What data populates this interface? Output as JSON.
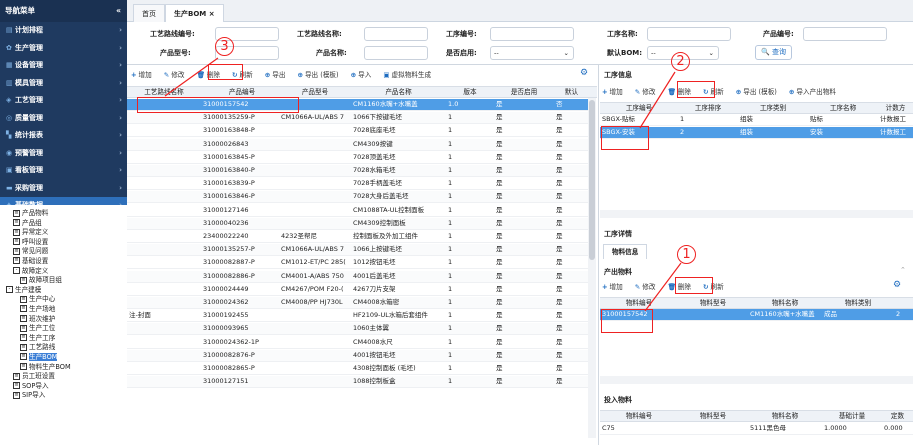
{
  "sidebar": {
    "title": "导航菜单",
    "collapse": "«",
    "menu": [
      {
        "label": "计划排程",
        "icon": "▤"
      },
      {
        "label": "生产管理",
        "icon": "✿"
      },
      {
        "label": "设备管理",
        "icon": "▦"
      },
      {
        "label": "模具管理",
        "icon": "▥"
      },
      {
        "label": "工艺管理",
        "icon": "◈"
      },
      {
        "label": "质量管理",
        "icon": "◎"
      },
      {
        "label": "统计报表",
        "icon": "▚"
      },
      {
        "label": "预警管理",
        "icon": "◉"
      },
      {
        "label": "看板管理",
        "icon": "▣"
      },
      {
        "label": "采购管理",
        "icon": "▬"
      },
      {
        "label": "基础数据",
        "icon": "✦"
      }
    ],
    "tree": [
      {
        "label": "产品物料",
        "d": 1,
        "t": "l"
      },
      {
        "label": "产品组",
        "d": 1,
        "t": "l"
      },
      {
        "label": "异常定义",
        "d": 1,
        "t": "l"
      },
      {
        "label": "呼叫设置",
        "d": 1,
        "t": "l"
      },
      {
        "label": "常见问题",
        "d": 1,
        "t": "l"
      },
      {
        "label": "基础设置",
        "d": 1,
        "t": "l"
      },
      {
        "label": "故障定义",
        "d": 1,
        "t": "f"
      },
      {
        "label": "故障项目组",
        "d": 2,
        "t": "l"
      },
      {
        "label": "生产建模",
        "d": 0,
        "t": "f"
      },
      {
        "label": "生产中心",
        "d": 2,
        "t": "l"
      },
      {
        "label": "生产场地",
        "d": 2,
        "t": "l"
      },
      {
        "label": "班次维护",
        "d": 2,
        "t": "l"
      },
      {
        "label": "生产工位",
        "d": 2,
        "t": "l"
      },
      {
        "label": "生产工序",
        "d": 2,
        "t": "l"
      },
      {
        "label": "工艺路线",
        "d": 2,
        "t": "l"
      },
      {
        "label": "生产BOM",
        "d": 2,
        "t": "l",
        "sel": true
      },
      {
        "label": "物料生产BOM",
        "d": 2,
        "t": "l"
      },
      {
        "label": "员工班设置",
        "d": 1,
        "t": "l"
      },
      {
        "label": "SOP导入",
        "d": 1,
        "t": "l"
      },
      {
        "label": "SIP导入",
        "d": 1,
        "t": "l"
      }
    ]
  },
  "tabs": [
    "首页",
    "生产BOM ×"
  ],
  "filters": {
    "route_no": "工艺路线编号:",
    "route_name": "工艺路线名称:",
    "proc_no": "工序编号:",
    "proc_name": "工序名称:",
    "prod_no": "产品编号:",
    "prod_type": "产品型号:",
    "prod_name": "产品名称:",
    "enabled": "是否启用:",
    "enabled_val": "--",
    "def_bom": "默认BOM:",
    "def_bom_val": "--",
    "query": "查询"
  },
  "left_toolbar": [
    "增加",
    "修改",
    "删除",
    "刷新",
    "导出",
    "导出 (模板)",
    "导入",
    "虚拟物料生成"
  ],
  "left_headers": [
    "工艺路线名称",
    "产品编号",
    "产品型号",
    "产品名称",
    "版本",
    "是否启用",
    "默认"
  ],
  "left_rows": [
    [
      "",
      "31000157542",
      "",
      "CM1160水嘴+水嘴盖",
      "1.0",
      "是",
      "否"
    ],
    [
      "",
      "31000135259-P",
      "CM1066A-UL/ABS 7",
      "1066下按键毛坯",
      "1",
      "是",
      "是"
    ],
    [
      "",
      "31000163848-P",
      "",
      "7028底座毛坯",
      "1",
      "是",
      "是"
    ],
    [
      "",
      "31000026843",
      "",
      "CM4309按键",
      "1",
      "是",
      "是"
    ],
    [
      "",
      "31000163845-P",
      "",
      "7028顶盖毛坯",
      "1",
      "是",
      "是"
    ],
    [
      "",
      "31000163840-P",
      "",
      "7028水箱毛坯",
      "1",
      "是",
      "是"
    ],
    [
      "",
      "31000163839-P",
      "",
      "7028手柄盖毛坯",
      "1",
      "是",
      "是"
    ],
    [
      "",
      "31000163846-P",
      "",
      "7028大身后盖毛坯",
      "1",
      "是",
      "是"
    ],
    [
      "",
      "31000127146",
      "",
      "CM1088TA-UL控制面板",
      "1",
      "是",
      "是"
    ],
    [
      "",
      "31000040236",
      "",
      "CM4309控制面板",
      "1",
      "是",
      "是"
    ],
    [
      "",
      "23400022240",
      "4232圣帮尼",
      "控制面板及外加工组件",
      "1",
      "是",
      "是"
    ],
    [
      "",
      "31000135257-P",
      "CM1066A-UL/ABS 7",
      "1066上按键毛坯",
      "1",
      "是",
      "是"
    ],
    [
      "",
      "31000082887-P",
      "CM1012-ET/PC 285(",
      "1012按钮毛坯",
      "1",
      "是",
      "是"
    ],
    [
      "",
      "31000082886-P",
      "CM4001-A/ABS 750",
      "4001后盖毛坯",
      "1",
      "是",
      "是"
    ],
    [
      "",
      "31000024449",
      "CM4267/POM F20-(",
      "4267刀片支架",
      "1",
      "是",
      "是"
    ],
    [
      "",
      "31000024362",
      "CM4008/PP HJ730L",
      "CM4008水箱密",
      "1",
      "是",
      "是"
    ],
    [
      "注-封面",
      "31000192455",
      "",
      "HF2109-UL水箱后套组件",
      "1",
      "是",
      "是"
    ],
    [
      "",
      "31000093965",
      "",
      "1060主体翼",
      "1",
      "是",
      "是"
    ],
    [
      "",
      "31000024362-1P",
      "",
      "CM4008水尺",
      "1",
      "是",
      "是"
    ],
    [
      "",
      "31000082876-P",
      "",
      "4001按钮毛坯",
      "1",
      "是",
      "是"
    ],
    [
      "",
      "31000082865-P",
      "",
      "4308控制面板 (毛坯)",
      "1",
      "是",
      "是"
    ],
    [
      "",
      "31000127151",
      "",
      "1088控制板盒",
      "1",
      "是",
      "是"
    ]
  ],
  "proc": {
    "title": "工序信息",
    "toolbar": [
      "增加",
      "修改",
      "删除",
      "刷新",
      "导出 (模板)",
      "导入产出物料"
    ],
    "headers": [
      "工序编号",
      "工序排序",
      "工序类别",
      "工序名称",
      "计数方"
    ],
    "rows": [
      [
        "SBGX-贴标",
        "1",
        "组装",
        "贴标",
        "计数报工"
      ],
      [
        "SBGX-安装",
        "2",
        "组装",
        "安装",
        "计数报工"
      ]
    ]
  },
  "detail": {
    "title": "工序详情",
    "tab": "物料信息",
    "out_title": "产出物料",
    "toolbar": [
      "增加",
      "修改",
      "删除",
      "刷新"
    ],
    "headers": [
      "物料编号",
      "物料型号",
      "物料名称",
      "物料类别",
      ""
    ],
    "rows": [
      [
        "31000157542",
        "",
        "CM1160水嘴+水嘴盖",
        "成品",
        "2"
      ]
    ]
  },
  "input": {
    "title": "投入物料",
    "headers": [
      "物料编号",
      "物料型号",
      "物料名称",
      "基础计量",
      "定数"
    ],
    "rows": [
      [
        "C75",
        "",
        "5111黑色母",
        "1.0000",
        "0.000"
      ]
    ]
  },
  "annotations": [
    "1",
    "2",
    "3"
  ]
}
